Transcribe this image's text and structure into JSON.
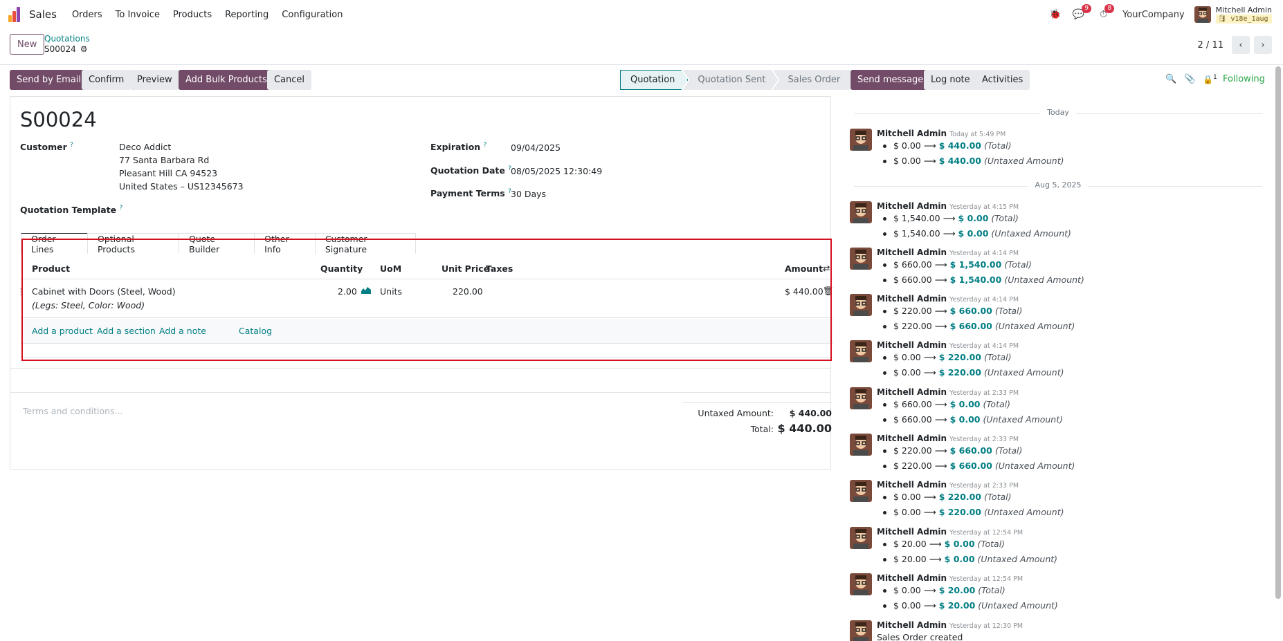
{
  "nav": {
    "app_name": "Sales",
    "menu": [
      "Orders",
      "To Invoice",
      "Products",
      "Reporting",
      "Configuration"
    ],
    "messages_badge": "9",
    "activities_badge": "8",
    "company": "YourCompany",
    "user_name": "Mitchell Admin",
    "db_name": "v18e_1aug"
  },
  "control": {
    "new_label": "New",
    "breadcrumb": "Quotations",
    "record": "S00024",
    "pager": "2 / 11"
  },
  "actions": {
    "send_email": "Send by Email",
    "confirm": "Confirm",
    "preview": "Preview",
    "bulk": "Add Bulk Products",
    "cancel": "Cancel"
  },
  "stages": [
    "Quotation",
    "Quotation Sent",
    "Sales Order"
  ],
  "form": {
    "title": "S00024",
    "customer_label": "Customer",
    "customer_lines": [
      "Deco Addict",
      "77 Santa Barbara Rd",
      "Pleasant Hill CA 94523",
      "United States – US12345673"
    ],
    "template_label": "Quotation Template",
    "expiration_label": "Expiration",
    "expiration": "09/04/2025",
    "qdate_label": "Quotation Date",
    "qdate": "08/05/2025 12:30:49",
    "terms_label": "Payment Terms",
    "terms": "30 Days"
  },
  "tabs": [
    "Order Lines",
    "Optional Products",
    "Quote Builder",
    "Other Info",
    "Customer Signature"
  ],
  "order_lines": {
    "headers": {
      "product": "Product",
      "quantity": "Quantity",
      "uom": "UoM",
      "unit_price": "Unit Price",
      "taxes": "Taxes",
      "amount": "Amount"
    },
    "rows": [
      {
        "product": "Cabinet with Doors (Steel, Wood)",
        "variant": "(Legs: Steel, Color: Wood)",
        "quantity": "2.00",
        "uom": "Units",
        "unit_price": "220.00",
        "amount": "$ 440.00"
      }
    ],
    "add_product": "Add a product",
    "add_section": "Add a section",
    "add_note": "Add a note",
    "catalog": "Catalog"
  },
  "footer": {
    "terms_placeholder": "Terms and conditions...",
    "untaxed_label": "Untaxed Amount:",
    "untaxed": "$ 440.00",
    "total_label": "Total:",
    "total": "$ 440.00"
  },
  "chatter": {
    "send_message": "Send message",
    "log_note": "Log note",
    "activities": "Activities",
    "followers_count": "1",
    "following": "Following",
    "date_today": "Today",
    "date_aug": "Aug 5, 2025",
    "messages": [
      {
        "author": "Mitchell Admin",
        "time": "Today at 5:49 PM",
        "l1_old": "$ 0.00",
        "l1_new": "$ 440.00",
        "l1_field": "(Total)",
        "l2_old": "$ 0.00",
        "l2_new": "$ 440.00",
        "l2_field": "(Untaxed Amount)"
      },
      {
        "author": "Mitchell Admin",
        "time": "Yesterday at 4:15 PM",
        "l1_old": "$ 1,540.00",
        "l1_new": "$ 0.00",
        "l1_field": "(Total)",
        "l2_old": "$ 1,540.00",
        "l2_new": "$ 0.00",
        "l2_field": "(Untaxed Amount)"
      },
      {
        "author": "Mitchell Admin",
        "time": "Yesterday at 4:14 PM",
        "l1_old": "$ 660.00",
        "l1_new": "$ 1,540.00",
        "l1_field": "(Total)",
        "l2_old": "$ 660.00",
        "l2_new": "$ 1,540.00",
        "l2_field": "(Untaxed Amount)"
      },
      {
        "author": "Mitchell Admin",
        "time": "Yesterday at 4:14 PM",
        "l1_old": "$ 220.00",
        "l1_new": "$ 660.00",
        "l1_field": "(Total)",
        "l2_old": "$ 220.00",
        "l2_new": "$ 660.00",
        "l2_field": "(Untaxed Amount)"
      },
      {
        "author": "Mitchell Admin",
        "time": "Yesterday at 4:14 PM",
        "l1_old": "$ 0.00",
        "l1_new": "$ 220.00",
        "l1_field": "(Total)",
        "l2_old": "$ 0.00",
        "l2_new": "$ 220.00",
        "l2_field": "(Untaxed Amount)"
      },
      {
        "author": "Mitchell Admin",
        "time": "Yesterday at 2:33 PM",
        "l1_old": "$ 660.00",
        "l1_new": "$ 0.00",
        "l1_field": "(Total)",
        "l2_old": "$ 660.00",
        "l2_new": "$ 0.00",
        "l2_field": "(Untaxed Amount)"
      },
      {
        "author": "Mitchell Admin",
        "time": "Yesterday at 2:33 PM",
        "l1_old": "$ 220.00",
        "l1_new": "$ 660.00",
        "l1_field": "(Total)",
        "l2_old": "$ 220.00",
        "l2_new": "$ 660.00",
        "l2_field": "(Untaxed Amount)"
      },
      {
        "author": "Mitchell Admin",
        "time": "Yesterday at 2:33 PM",
        "l1_old": "$ 0.00",
        "l1_new": "$ 220.00",
        "l1_field": "(Total)",
        "l2_old": "$ 0.00",
        "l2_new": "$ 220.00",
        "l2_field": "(Untaxed Amount)"
      },
      {
        "author": "Mitchell Admin",
        "time": "Yesterday at 12:54 PM",
        "l1_old": "$ 20.00",
        "l1_new": "$ 0.00",
        "l1_field": "(Total)",
        "l2_old": "$ 20.00",
        "l2_new": "$ 0.00",
        "l2_field": "(Untaxed Amount)"
      },
      {
        "author": "Mitchell Admin",
        "time": "Yesterday at 12:54 PM",
        "l1_old": "$ 0.00",
        "l1_new": "$ 20.00",
        "l1_field": "(Total)",
        "l2_old": "$ 0.00",
        "l2_new": "$ 20.00",
        "l2_field": "(Untaxed Amount)"
      }
    ],
    "last_author": "Mitchell Admin",
    "last_time": "Yesterday at 12:30 PM",
    "last_text": "Sales Order created"
  }
}
